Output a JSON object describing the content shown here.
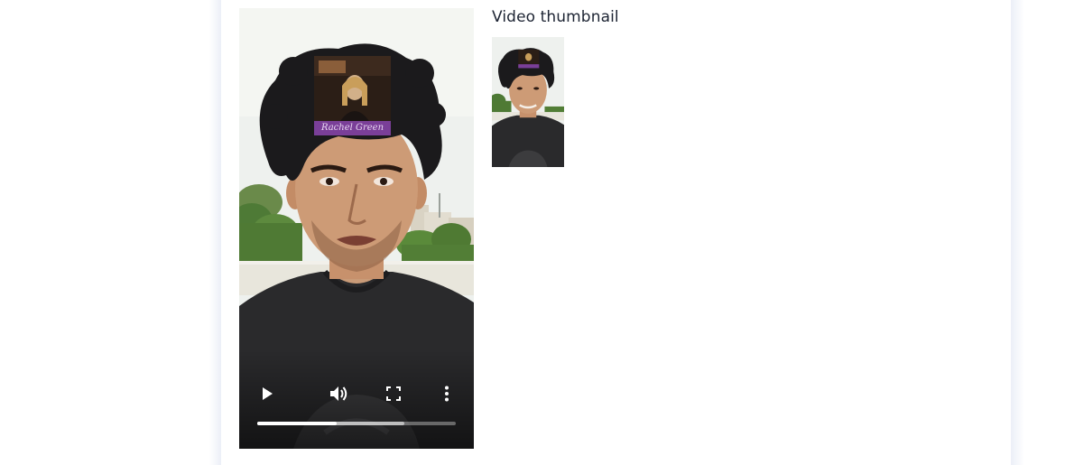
{
  "video": {
    "overlay_name": "Rachel Green",
    "progress_played": 0.4,
    "progress_buffered": 0.74,
    "controls": [
      "play",
      "volume",
      "fullscreen",
      "more-options"
    ]
  },
  "thumbnail": {
    "heading": "Video thumbnail"
  },
  "colors": {
    "overlay_label_bg": "#7a3f98",
    "card_shadow": "#e8ecf6",
    "heading_text": "#1d2433",
    "shirt": "#2a2a2c",
    "sky": "#eef1ee"
  }
}
